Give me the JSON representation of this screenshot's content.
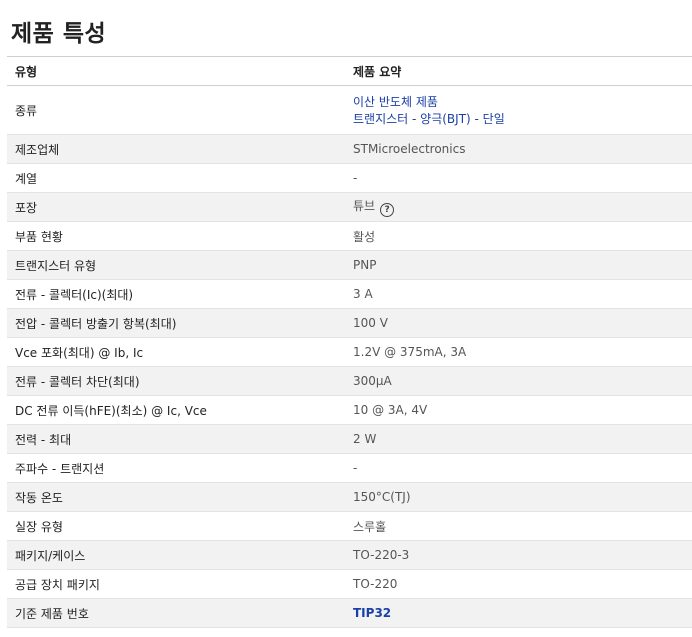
{
  "title": "제품 특성",
  "header": {
    "col1": "유형",
    "col2": "제품 요약"
  },
  "rows": [
    {
      "attr": "종류",
      "val1": "이산 반도체 제품",
      "val2": "트랜지스터 - 양극(BJT) - 단일"
    },
    {
      "attr": "제조업체",
      "val": "STMicroelectronics"
    },
    {
      "attr": "계열",
      "val": "-"
    },
    {
      "attr": "포장",
      "val": "튜브",
      "icon": "help-circle-icon"
    },
    {
      "attr": "부품 현황",
      "val": "활성"
    },
    {
      "attr": "트랜지스터 유형",
      "val": "PNP"
    },
    {
      "attr": "전류 - 콜렉터(Ic)(최대)",
      "val": "3 A"
    },
    {
      "attr": "전압 - 콜렉터 방출기 항복(최대)",
      "val": "100 V"
    },
    {
      "attr": "Vce 포화(최대) @ Ib, Ic",
      "val": "1.2V @ 375mA, 3A"
    },
    {
      "attr": "전류 - 콜렉터 차단(최대)",
      "val": "300µA"
    },
    {
      "attr": "DC 전류 이득(hFE)(최소) @ Ic, Vce",
      "val": "10 @ 3A, 4V"
    },
    {
      "attr": "전력 - 최대",
      "val": "2 W"
    },
    {
      "attr": "주파수 - 트랜지션",
      "val": "-"
    },
    {
      "attr": "작동 온도",
      "val": "150°C(TJ)"
    },
    {
      "attr": "실장 유형",
      "val": "스루홀"
    },
    {
      "attr": "패키지/케이스",
      "val": "TO-220-3"
    },
    {
      "attr": "공급 장치 패키지",
      "val": "TO-220"
    },
    {
      "attr": "기준 제품 번호",
      "val": "TIP32"
    }
  ],
  "colors": {
    "link": "#1a3fa6",
    "stripe": "#f2f2f2"
  }
}
